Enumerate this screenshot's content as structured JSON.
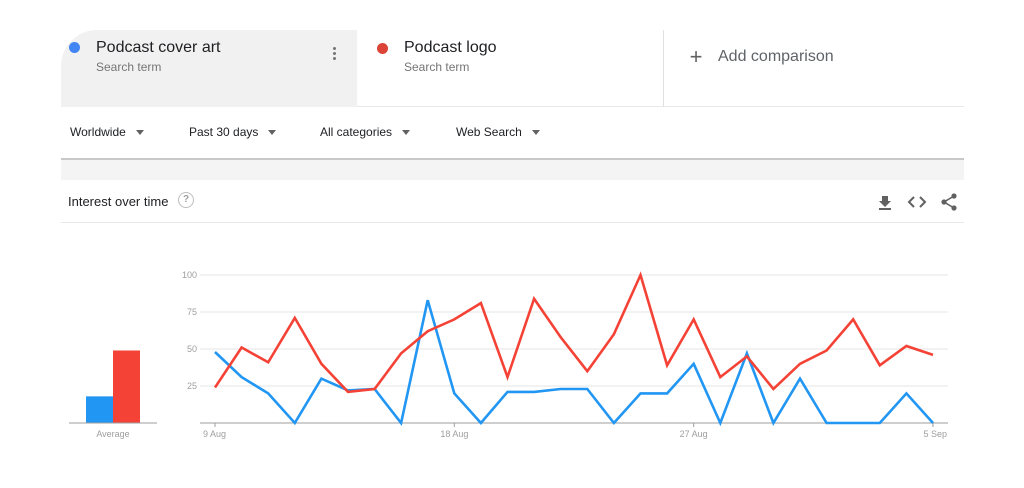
{
  "terms": [
    {
      "name": "Podcast cover art",
      "subtitle": "Search term",
      "color": "#4285f4"
    },
    {
      "name": "Podcast logo",
      "subtitle": "Search term",
      "color": "#db4437"
    }
  ],
  "add_comparison": "Add comparison",
  "filters": {
    "region": "Worldwide",
    "period": "Past 30 days",
    "category": "All categories",
    "search_type": "Web Search"
  },
  "card": {
    "title": "Interest over time",
    "help": "?"
  },
  "chart_data": {
    "type": "line",
    "ylim": [
      0,
      100
    ],
    "yticks": [
      "100",
      "75",
      "50",
      "25"
    ],
    "ytick_values": [
      100,
      75,
      50,
      25
    ],
    "xticks": [
      {
        "label": "9 Aug",
        "index": 0
      },
      {
        "label": "18 Aug",
        "index": 9
      },
      {
        "label": "27 Aug",
        "index": 18
      },
      {
        "label": "5 Sep",
        "index": 27
      }
    ],
    "x": [
      "9 Aug",
      "10 Aug",
      "11 Aug",
      "12 Aug",
      "13 Aug",
      "14 Aug",
      "15 Aug",
      "16 Aug",
      "17 Aug",
      "18 Aug",
      "19 Aug",
      "20 Aug",
      "21 Aug",
      "22 Aug",
      "23 Aug",
      "24 Aug",
      "25 Aug",
      "26 Aug",
      "27 Aug",
      "28 Aug",
      "29 Aug",
      "30 Aug",
      "31 Aug",
      "1 Sep",
      "2 Sep",
      "3 Sep",
      "4 Sep",
      "5 Sep"
    ],
    "series": [
      {
        "name": "Podcast cover art",
        "color": "#2196f3",
        "values": [
          48,
          31,
          20,
          0,
          30,
          22,
          23,
          0,
          83,
          20,
          0,
          21,
          21,
          23,
          23,
          0,
          20,
          20,
          40,
          0,
          47,
          0,
          30,
          0,
          0,
          0,
          20,
          0
        ]
      },
      {
        "name": "Podcast logo",
        "color": "#f44336",
        "values": [
          24,
          51,
          41,
          71,
          40,
          21,
          23,
          47,
          62,
          70,
          81,
          31,
          84,
          58,
          35,
          60,
          100,
          39,
          70,
          31,
          45,
          23,
          40,
          49,
          70,
          39,
          52,
          46
        ]
      }
    ],
    "averages": {
      "label": "Average",
      "values": [
        18,
        49
      ]
    }
  }
}
